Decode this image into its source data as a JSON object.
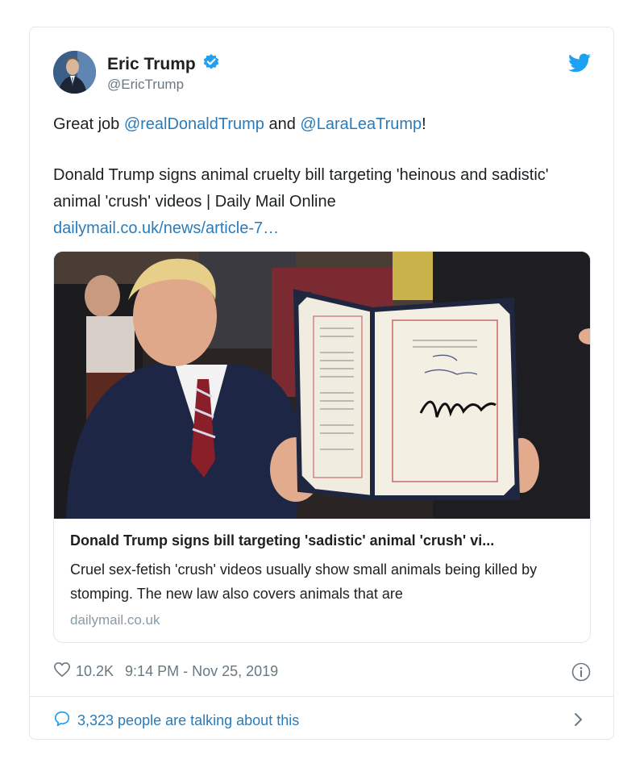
{
  "tweet": {
    "author_name": "Eric Trump",
    "author_handle": "@EricTrump",
    "verified": true,
    "text_prefix": "Great job ",
    "mention_1": "@realDonaldTrump",
    "text_and": " and ",
    "mention_2": "@LaraLeaTrump",
    "text_suffix": "!",
    "body_line": "Donald Trump signs animal cruelty bill targeting 'heinous and sadistic' animal 'crush' videos | Daily Mail Online",
    "link": "dailymail.co.uk/news/article-7…"
  },
  "preview": {
    "title": "Donald Trump signs bill targeting 'sadistic' animal 'crush' vi...",
    "description": "Cruel sex-fetish 'crush' videos usually show small animals being killed by stomping. The new law also covers animals that are",
    "domain": "dailymail.co.uk"
  },
  "meta": {
    "likes": "10.2K",
    "timestamp": "9:14 PM - Nov 25, 2019"
  },
  "footer": {
    "talking": "3,323 people are talking about this"
  },
  "icons": {
    "verified": "verified-badge-icon",
    "bird": "twitter-bird-icon",
    "heart": "heart-icon",
    "info": "info-icon",
    "speech": "speech-bubble-icon",
    "chevron": "chevron-right-icon"
  },
  "colors": {
    "accent": "#1da1f2",
    "link": "#2b7bb9",
    "muted": "#697882",
    "border": "#e1e8ed"
  }
}
